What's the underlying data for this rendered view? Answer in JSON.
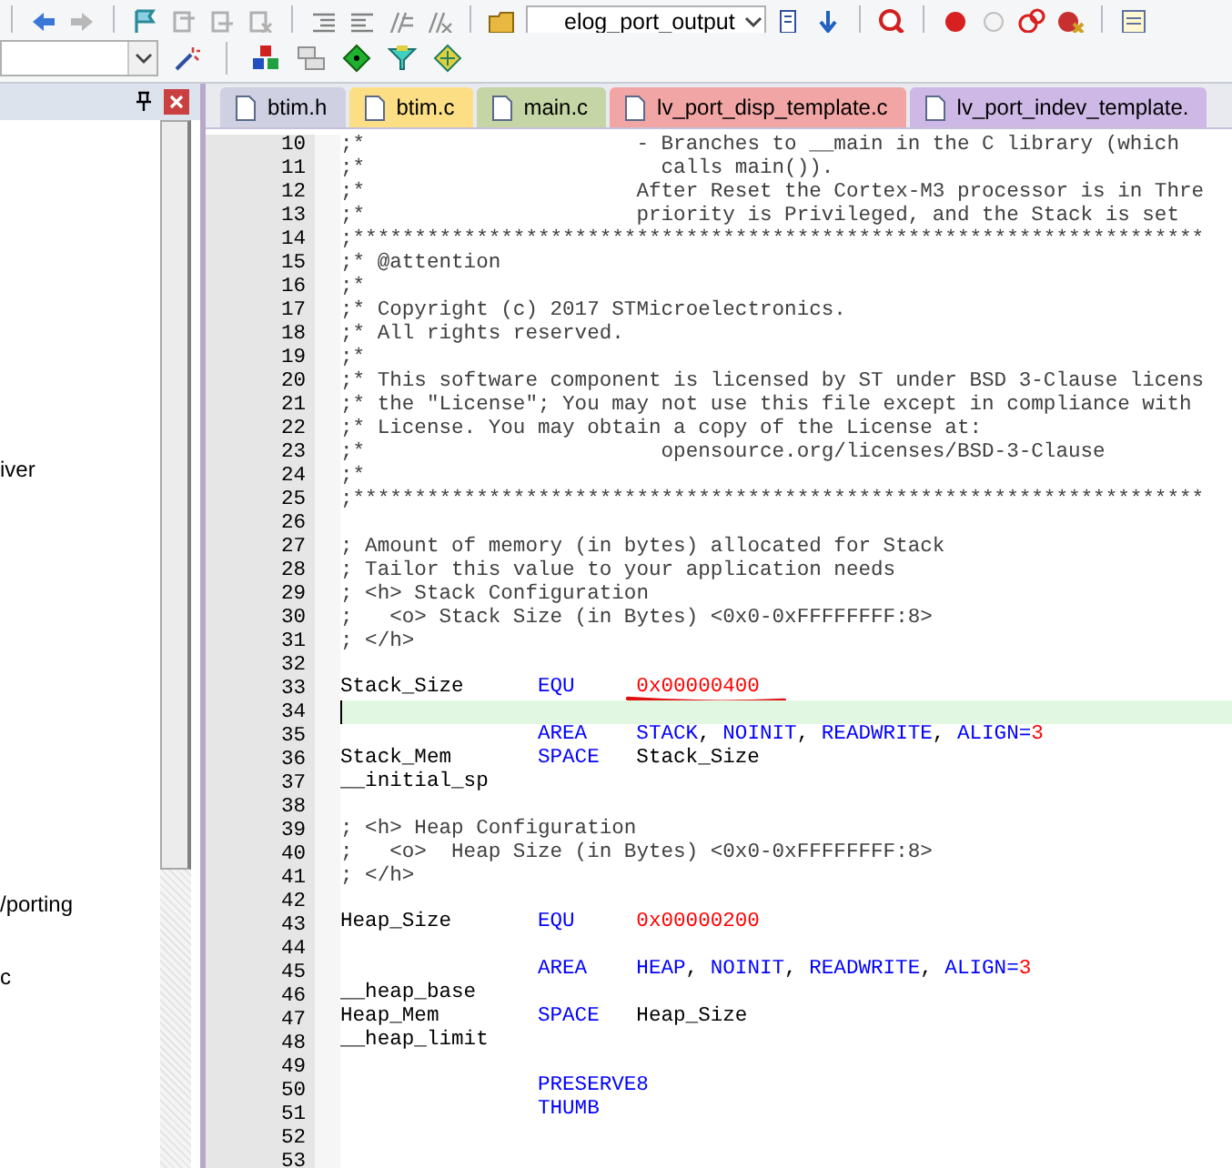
{
  "toolbar": {
    "target_dropdown": "elog_port_output"
  },
  "sidebar": {
    "items": [
      {
        "label": "iver"
      },
      {
        "label": "/porting"
      },
      {
        "label": "c"
      }
    ]
  },
  "tabs": [
    {
      "label": "btim.h",
      "color": "#cfd0e2"
    },
    {
      "label": "btim.c",
      "color": "#fcdf85"
    },
    {
      "label": "main.c",
      "color": "#c5d5a5"
    },
    {
      "label": "lv_port_disp_template.c",
      "color": "#f2a5a5"
    },
    {
      "label": "lv_port_indev_template.",
      "color": "#cdb8e6"
    }
  ],
  "editor": {
    "lines": [
      {
        "number": "10",
        "kind": "comment",
        "text": ";*                      - Branches to __main in the C library (which",
        "current": false
      },
      {
        "number": "11",
        "kind": "comment",
        "text": ";*                        calls main()).",
        "current": false
      },
      {
        "number": "12",
        "kind": "comment",
        "text": ";*                      After Reset the Cortex-M3 processor is in Thre",
        "current": false
      },
      {
        "number": "13",
        "kind": "comment",
        "text": ";*                      priority is Privileged, and the Stack is set",
        "current": false
      },
      {
        "number": "14",
        "kind": "comment",
        "text": ";*********************************************************************",
        "current": false
      },
      {
        "number": "15",
        "kind": "comment",
        "text": ";* @attention",
        "current": false
      },
      {
        "number": "16",
        "kind": "comment",
        "text": ";*",
        "current": false
      },
      {
        "number": "17",
        "kind": "comment",
        "text": ";* Copyright (c) 2017 STMicroelectronics.",
        "current": false
      },
      {
        "number": "18",
        "kind": "comment",
        "text": ";* All rights reserved.",
        "current": false
      },
      {
        "number": "19",
        "kind": "comment",
        "text": ";*",
        "current": false
      },
      {
        "number": "20",
        "kind": "comment",
        "text": ";* This software component is licensed by ST under BSD 3-Clause licens",
        "current": false
      },
      {
        "number": "21",
        "kind": "comment",
        "text": ";* the \"License\"; You may not use this file except in compliance with",
        "current": false
      },
      {
        "number": "22",
        "kind": "comment",
        "text": ";* License. You may obtain a copy of the License at:",
        "current": false
      },
      {
        "number": "23",
        "kind": "comment",
        "text": ";*                        opensource.org/licenses/BSD-3-Clause",
        "current": false
      },
      {
        "number": "24",
        "kind": "comment",
        "text": ";*",
        "current": false
      },
      {
        "number": "25",
        "kind": "comment",
        "text": ";*********************************************************************",
        "current": false
      },
      {
        "number": "26",
        "kind": "blank",
        "current": false
      },
      {
        "number": "27",
        "kind": "comment",
        "text": "; Amount of memory (in bytes) allocated for Stack",
        "current": false
      },
      {
        "number": "28",
        "kind": "comment",
        "text": "; Tailor this value to your application needs",
        "current": false
      },
      {
        "number": "29",
        "kind": "comment",
        "text": "; <h> Stack Configuration",
        "current": false
      },
      {
        "number": "30",
        "kind": "comment",
        "text": ";   <o> Stack Size (in Bytes) <0x0-0xFFFFFFFF:8>",
        "current": false
      },
      {
        "number": "31",
        "kind": "comment",
        "text": "; </h>",
        "current": false
      },
      {
        "number": "32",
        "kind": "blank",
        "current": false
      },
      {
        "number": "33",
        "kind": "code",
        "label": "Stack_Size",
        "op": "EQU",
        "args": [
          {
            "kind": "number",
            "text": "0x00000400"
          }
        ],
        "underlined": true,
        "current": false
      },
      {
        "number": "34",
        "kind": "blank",
        "current": true
      },
      {
        "number": "35",
        "kind": "code",
        "op": "AREA",
        "args": [
          {
            "kind": "keyword",
            "text": "STACK"
          },
          {
            "kind": "plain",
            "text": ","
          },
          {
            "kind": "keyword",
            "text": " NOINIT"
          },
          {
            "kind": "plain",
            "text": ","
          },
          {
            "kind": "keyword",
            "text": " READWRITE"
          },
          {
            "kind": "plain",
            "text": ","
          },
          {
            "kind": "keyword",
            "text": " ALIGN="
          },
          {
            "kind": "number",
            "text": "3"
          }
        ],
        "underlined": false,
        "current": false
      },
      {
        "number": "36",
        "kind": "code",
        "label": "Stack_Mem",
        "op": "SPACE",
        "args": [
          {
            "kind": "plain",
            "text": "Stack_Size"
          }
        ],
        "underlined": false,
        "current": false
      },
      {
        "number": "37",
        "kind": "code",
        "label": "__initial_sp",
        "underlined": false,
        "current": false
      },
      {
        "number": "38",
        "kind": "blank",
        "current": false
      },
      {
        "number": "39",
        "kind": "comment",
        "text": "; <h> Heap Configuration",
        "current": false
      },
      {
        "number": "40",
        "kind": "comment",
        "text": ";   <o>  Heap Size (in Bytes) <0x0-0xFFFFFFFF:8>",
        "current": false
      },
      {
        "number": "41",
        "kind": "comment",
        "text": "; </h>",
        "current": false
      },
      {
        "number": "42",
        "kind": "blank",
        "current": false
      },
      {
        "number": "43",
        "kind": "code",
        "label": "Heap_Size",
        "op": "EQU",
        "args": [
          {
            "kind": "number",
            "text": "0x00000200"
          }
        ],
        "underlined": false,
        "current": false
      },
      {
        "number": "44",
        "kind": "blank",
        "current": false
      },
      {
        "number": "45",
        "kind": "code",
        "op": "AREA",
        "args": [
          {
            "kind": "keyword",
            "text": "HEAP"
          },
          {
            "kind": "plain",
            "text": ","
          },
          {
            "kind": "keyword",
            "text": " NOINIT"
          },
          {
            "kind": "plain",
            "text": ","
          },
          {
            "kind": "keyword",
            "text": " READWRITE"
          },
          {
            "kind": "plain",
            "text": ","
          },
          {
            "kind": "keyword",
            "text": " ALIGN="
          },
          {
            "kind": "number",
            "text": "3"
          }
        ],
        "underlined": false,
        "current": false
      },
      {
        "number": "46",
        "kind": "code",
        "label": "__heap_base",
        "underlined": false,
        "current": false
      },
      {
        "number": "47",
        "kind": "code",
        "label": "Heap_Mem",
        "op": "SPACE",
        "args": [
          {
            "kind": "plain",
            "text": "Heap_Size"
          }
        ],
        "underlined": false,
        "current": false
      },
      {
        "number": "48",
        "kind": "code",
        "label": "__heap_limit",
        "underlined": false,
        "current": false
      },
      {
        "number": "49",
        "kind": "blank",
        "current": false
      },
      {
        "number": "50",
        "kind": "code",
        "op": "PRESERVE8",
        "underlined": false,
        "current": false
      },
      {
        "number": "51",
        "kind": "code",
        "op": "THUMB",
        "underlined": false,
        "current": false
      },
      {
        "number": "52",
        "kind": "blank",
        "current": false
      },
      {
        "number": "53",
        "kind": "blank",
        "current": false
      }
    ]
  }
}
